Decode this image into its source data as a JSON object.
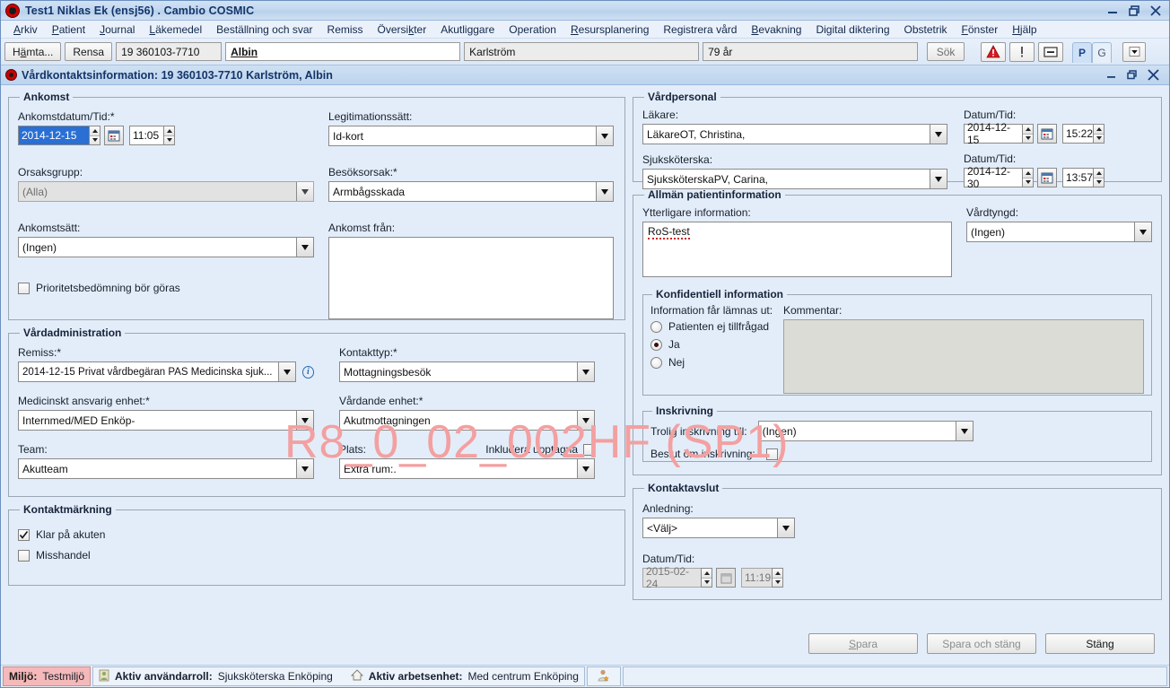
{
  "window": {
    "title": "Test1 Niklas Ek (ensj56) . Cambio COSMIC",
    "minimize": "minimize-icon",
    "restore": "restore-icon",
    "close": "close-icon"
  },
  "menubar": {
    "items": [
      {
        "label": "Arkiv",
        "mnemonic": "A"
      },
      {
        "label": "Patient",
        "mnemonic": "P"
      },
      {
        "label": "Journal",
        "mnemonic": "J"
      },
      {
        "label": "Läkemedel",
        "mnemonic": "L"
      },
      {
        "label": "Beställning och svar",
        "mnemonic": ""
      },
      {
        "label": "Remiss",
        "mnemonic": ""
      },
      {
        "label": "Översikter",
        "mnemonic": "k"
      },
      {
        "label": "Akutliggare",
        "mnemonic": ""
      },
      {
        "label": "Operation",
        "mnemonic": ""
      },
      {
        "label": "Resursplanering",
        "mnemonic": "R"
      },
      {
        "label": "Registrera vård",
        "mnemonic": ""
      },
      {
        "label": "Bevakning",
        "mnemonic": "B"
      },
      {
        "label": "Digital diktering",
        "mnemonic": ""
      },
      {
        "label": "Obstetrik",
        "mnemonic": ""
      },
      {
        "label": "Fönster",
        "mnemonic": "F"
      },
      {
        "label": "Hjälp",
        "mnemonic": "H"
      }
    ]
  },
  "toolbar": {
    "fetch_label": "Hämta...",
    "clear_label": "Rensa",
    "personal_number": "19 360103-7710",
    "first_name": "Albin",
    "last_name": "Karlström",
    "age": "79 år",
    "search_label": "Sök",
    "warning_icon": "warning-triangle-icon",
    "alert_icon": "exclamation-icon",
    "minus_icon": "minus-box-icon",
    "tab_p": "P",
    "tab_g": "G",
    "dropdown_icon": "chevron-down-icon"
  },
  "inner_window": {
    "title": "Vårdkontaktsinformation:  19 360103-7710 Karlström, Albin"
  },
  "watermark": "R8_0_02_002HF (SP1)",
  "ankomst": {
    "legend": "Ankomst",
    "arrival_date_label": "Ankomstdatum/Tid:*",
    "arrival_date": "2014-12-15",
    "arrival_time": "11:05",
    "calendar_icon": "calendar-icon",
    "legitimation_label": "Legitimationssätt:",
    "legitimation_value": "Id-kort",
    "cause_group_label": "Orsaksgrupp:",
    "cause_group_value": "(Alla)",
    "visit_reason_label": "Besöksorsak:*",
    "visit_reason_value": "Armbågsskada",
    "arrival_mode_label": "Ankomstsätt:",
    "arrival_mode_value": "(Ingen)",
    "arrival_from_label": "Ankomst från:",
    "arrival_from_value": "",
    "priority_checkbox_label": "Prioritetsbedömning bör göras",
    "priority_checked": false
  },
  "vardadministration": {
    "legend": "Vårdadministration",
    "remiss_label": "Remiss:*",
    "remiss_value": "2014-12-15 Privat vårdbegäran    PAS Medicinska sjuk...",
    "info_icon": "info-icon",
    "contact_type_label": "Kontakttyp:*",
    "contact_type_value": "Mottagningsbesök",
    "responsible_unit_label": "Medicinskt ansvarig enhet:*",
    "responsible_unit_value": "Internmed/MED Enköp-",
    "caring_unit_label": "Vårdande enhet:*",
    "caring_unit_value": "Akutmottagningen",
    "team_label": "Team:",
    "team_value": "Akutteam",
    "place_label": "Plats:",
    "place_value": "Extra rum:.",
    "include_occupied_label": "Inkludera upptagna",
    "include_occupied_checked": false
  },
  "kontaktmarkning": {
    "legend": "Kontaktmärkning",
    "items": [
      {
        "label": "Klar på akuten",
        "checked": true
      },
      {
        "label": "Misshandel",
        "checked": false
      }
    ]
  },
  "vardpersonal": {
    "legend": "Vårdpersonal",
    "doctor_label": "Läkare:",
    "doctor_value": "LäkareOT, Christina,",
    "doctor_datetime_label": "Datum/Tid:",
    "doctor_date": "2014-12-15",
    "doctor_time": "15:22",
    "nurse_label": "Sjuksköterska:",
    "nurse_value": "SjuksköterskaPV, Carina,",
    "nurse_datetime_label": "Datum/Tid:",
    "nurse_date": "2014-12-30",
    "nurse_time": "13:57",
    "calendar_icon": "calendar-icon"
  },
  "allman_patientinfo": {
    "legend": "Allmän patientinformation",
    "additional_info_label": "Ytterligare information:",
    "additional_info_value": "RoS-test",
    "care_weight_label": "Vårdtyngd:",
    "care_weight_value": "(Ingen)"
  },
  "konfidentiell": {
    "legend": "Konfidentiell information",
    "disclose_label": "Information får lämnas ut:",
    "comment_label": "Kommentar:",
    "comment_value": "",
    "options": [
      {
        "label": "Patienten ej tillfrågad",
        "selected": false
      },
      {
        "label": "Ja",
        "selected": true
      },
      {
        "label": "Nej",
        "selected": false
      }
    ]
  },
  "inskrivning": {
    "legend": "Inskrivning",
    "likely_admission_label": "Trolig inskrivning till:",
    "likely_admission_value": "(Ingen)",
    "decision_label": "Beslut om inskrivning:",
    "decision_checked": false
  },
  "kontaktavslut": {
    "legend": "Kontaktavslut",
    "reason_label": "Anledning:",
    "reason_value": "<Välj>",
    "datetime_label": "Datum/Tid:",
    "date": "2015-02-24",
    "time": "11:19",
    "calendar_icon": "calendar-icon"
  },
  "footer": {
    "save_label": "Spara",
    "save_mnemonic": "S",
    "save_and_close_label": "Spara och stäng",
    "close_label": "Stäng",
    "close_mnemonic": "g"
  },
  "statusbar": {
    "env_key": "Miljö:",
    "env_value": "Testmiljö",
    "role_key": "Aktiv användarroll:",
    "role_value": "Sjuksköterska Enköping",
    "unit_key": "Aktiv arbetsenhet:",
    "unit_value": "Med centrum Enköping",
    "user_icon": "user-icon",
    "home_icon": "home-icon",
    "person_star_icon": "person-star-icon"
  },
  "colors": {
    "accent": "#15366b",
    "panel_bg": "#e3edf9",
    "watermark": "#f3a0a0",
    "env_bg": "#f5b9b9",
    "warning_red": "#cc0000",
    "selection_blue": "#2a6fd4"
  }
}
